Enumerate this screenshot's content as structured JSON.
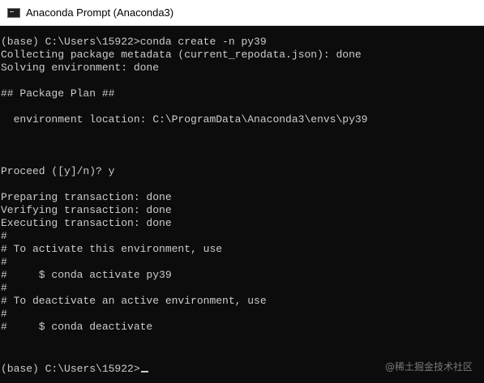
{
  "window": {
    "title": "Anaconda Prompt (Anaconda3)",
    "icon": "terminal-icon"
  },
  "console": {
    "lines": [
      "(base) C:\\Users\\15922>conda create -n py39",
      "Collecting package metadata (current_repodata.json): done",
      "Solving environment: done",
      "",
      "## Package Plan ##",
      "",
      "  environment location: C:\\ProgramData\\Anaconda3\\envs\\py39",
      "",
      "",
      "",
      "Proceed ([y]/n)? y",
      "",
      "Preparing transaction: done",
      "Verifying transaction: done",
      "Executing transaction: done",
      "#",
      "# To activate this environment, use",
      "#",
      "#     $ conda activate py39",
      "#",
      "# To deactivate an active environment, use",
      "#",
      "#     $ conda deactivate",
      "",
      "",
      "(base) C:\\Users\\15922>"
    ]
  },
  "watermark": "@稀土掘金技术社区",
  "colors": {
    "background": "#0c0c0c",
    "text": "#cccccc",
    "titlebar": "#ffffff"
  }
}
